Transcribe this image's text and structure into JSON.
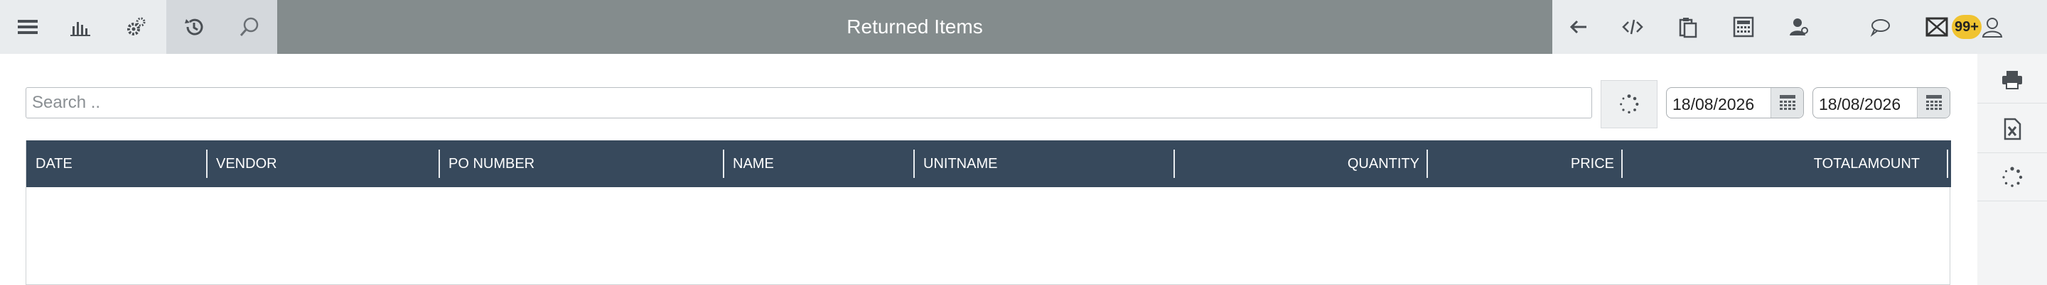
{
  "header": {
    "title": "Returned Items",
    "notification_count": "99+",
    "left_icons": [
      "menu-icon",
      "bar-chart-icon",
      "gears-icon",
      "history-icon",
      "search-icon"
    ],
    "right_icons": [
      "back-arrow-icon",
      "code-icon",
      "clipboard-icon",
      "calculator-icon",
      "user-admin-icon",
      "chat-bubble-icon",
      "mail-icon",
      "user-icon"
    ]
  },
  "filters": {
    "search_placeholder": "Search ..",
    "date_from": "18/08/2026",
    "date_to": "18/08/2026"
  },
  "table": {
    "columns": [
      "DATE",
      "VENDOR",
      "PO NUMBER",
      "NAME",
      "UNITNAME",
      "QUANTITY",
      "PRICE",
      "TOTALAMOUNT"
    ],
    "rows": []
  },
  "side_actions": [
    "printer-icon",
    "excel-export-icon",
    "refresh-icon"
  ],
  "colors": {
    "title_band": "#848c8d",
    "table_header": "#37495c",
    "badge": "#f0c330"
  }
}
